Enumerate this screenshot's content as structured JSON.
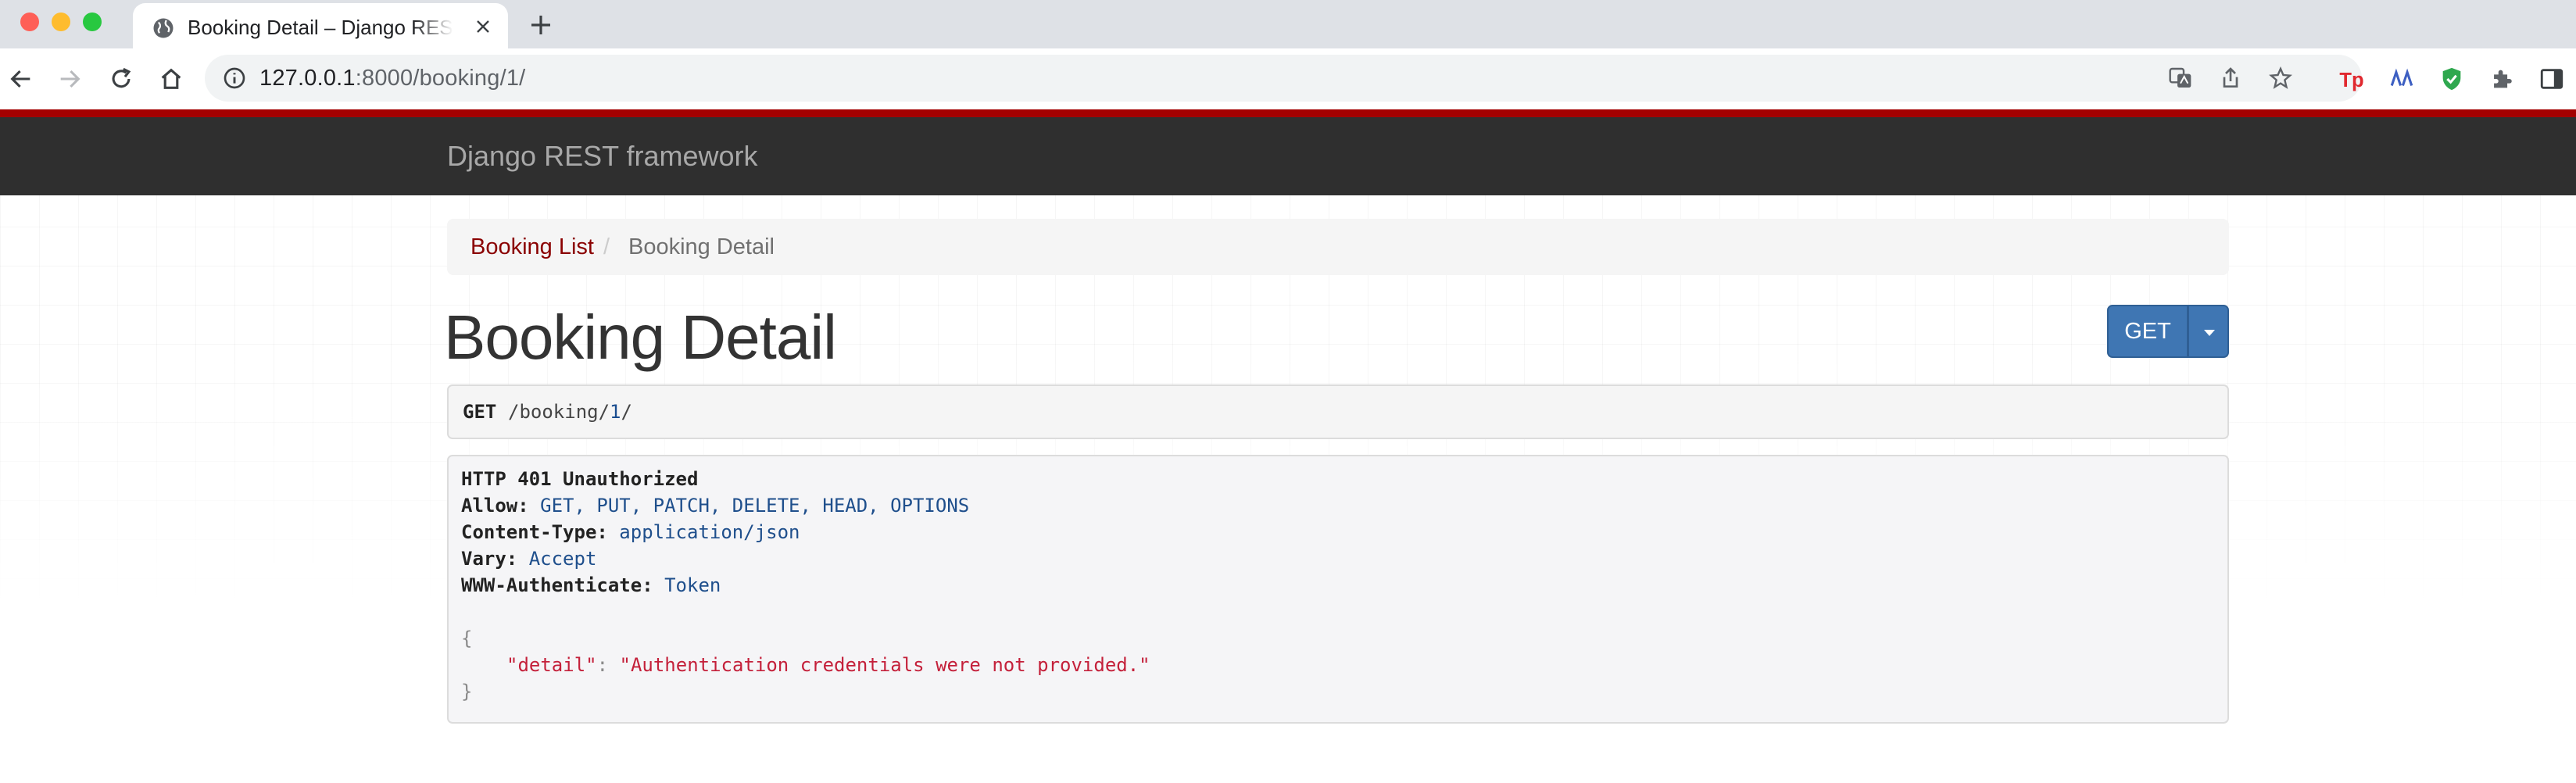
{
  "browser": {
    "tab_title": "Booking Detail – Django REST framework",
    "url_host": "127.0.0.1",
    "url_path": ":8000/booking/1/"
  },
  "navbar": {
    "brand": "Django REST framework"
  },
  "breadcrumb": {
    "items": [
      {
        "label": "Booking List",
        "active": false
      },
      {
        "label": "Booking Detail",
        "active": true
      }
    ],
    "separator": "/"
  },
  "page": {
    "title": "Booking Detail",
    "get_button": "GET"
  },
  "request": {
    "method": "GET",
    "path_prefix": "/booking/",
    "path_id": "1",
    "path_suffix": "/"
  },
  "response": {
    "status": "HTTP 401 Unauthorized",
    "headers": [
      {
        "key": "Allow:",
        "value": "GET, PUT, PATCH, DELETE, HEAD, OPTIONS"
      },
      {
        "key": "Content-Type:",
        "value": "application/json"
      },
      {
        "key": "Vary:",
        "value": "Accept"
      },
      {
        "key": "WWW-Authenticate:",
        "value": "Token"
      }
    ],
    "body": {
      "open": "{",
      "key": "\"detail\"",
      "colon": ":",
      "value": "\"Authentication credentials were not provided.\"",
      "close": "}"
    }
  },
  "colors": {
    "accent_red": "#a30000",
    "navbar": "#2f2f2f",
    "button_blue": "#3f76b3",
    "json_red": "#c4203a",
    "header_value_blue": "#1f4f8c"
  }
}
